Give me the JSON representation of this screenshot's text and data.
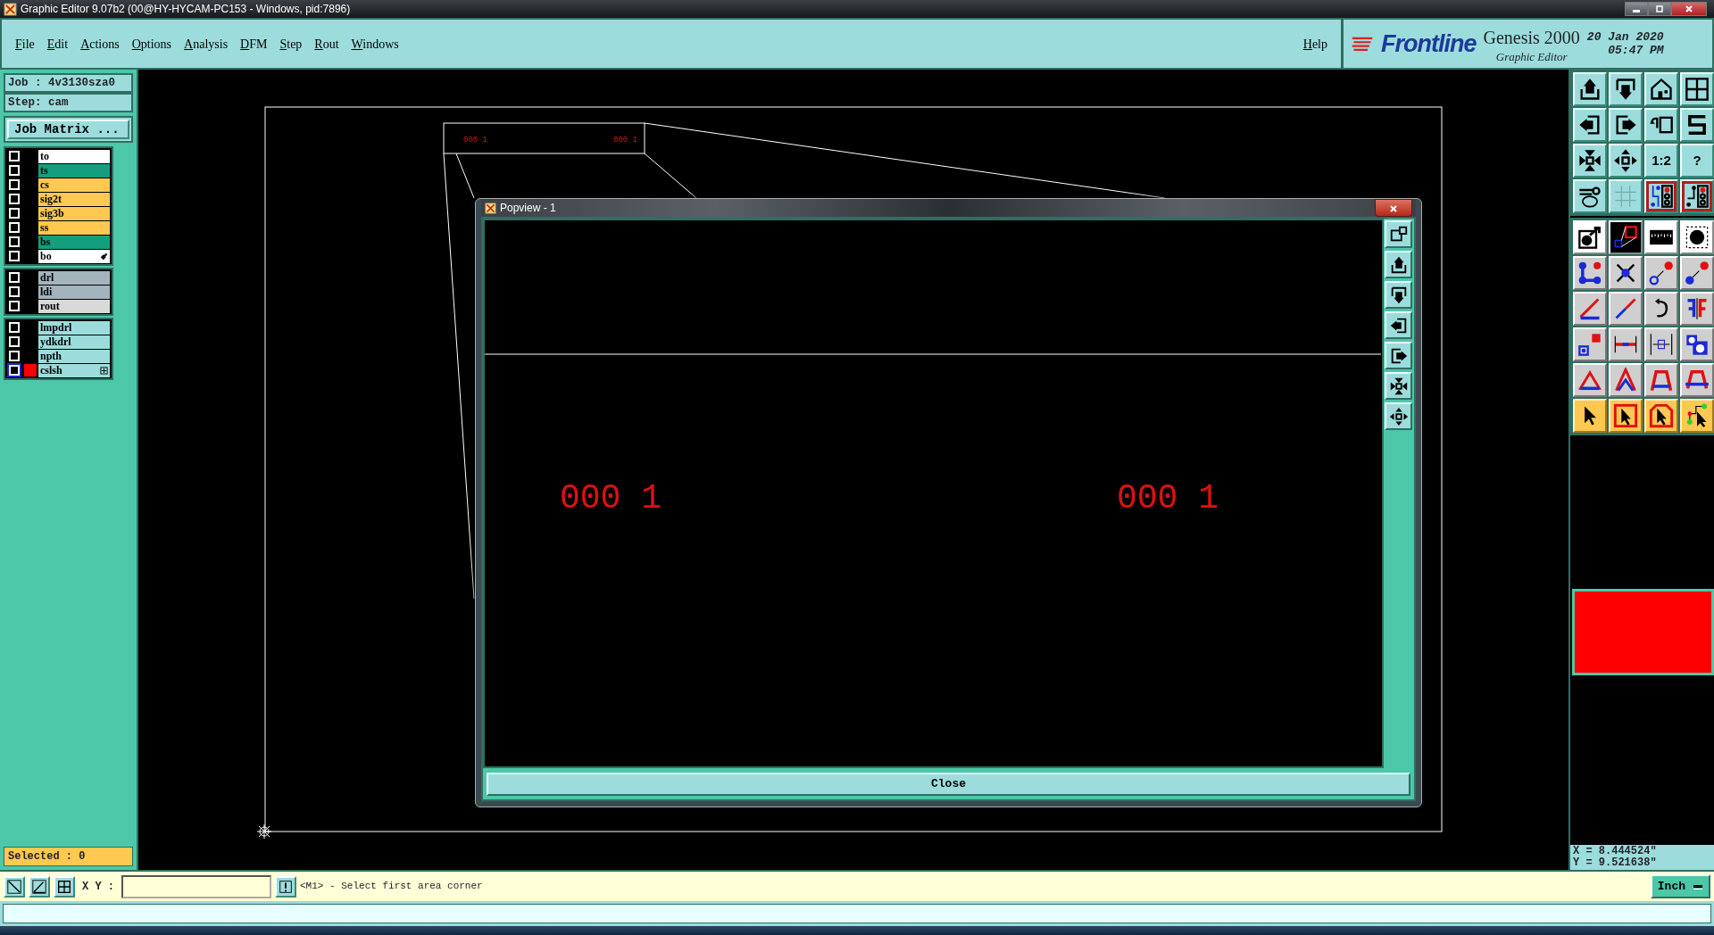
{
  "window": {
    "title": "Graphic Editor 9.07b2 (00@HY-HYCAM-PC153 - Windows, pid:7896)"
  },
  "menu": [
    {
      "label": "File"
    },
    {
      "label": "Edit"
    },
    {
      "label": "Actions"
    },
    {
      "label": "Options"
    },
    {
      "label": "Analysis"
    },
    {
      "label": "DFM"
    },
    {
      "label": "Step"
    },
    {
      "label": "Rout"
    },
    {
      "label": "Windows"
    }
  ],
  "help": "Help",
  "brand": {
    "logo": "Frontline",
    "product": "Genesis 2000",
    "subtitle": "Graphic Editor",
    "date": "20 Jan 2020",
    "time": "05:47 PM"
  },
  "job": {
    "job": "Job : 4v3130sza0",
    "step": "Step: cam",
    "matrix_button": "Job Matrix ..."
  },
  "layer_groups": [
    [
      {
        "name": "to",
        "color": "#ffffff",
        "checked": false,
        "displayed": false,
        "focused": false,
        "work": false,
        "expander": false
      },
      {
        "name": "ts",
        "color": "#139e7e",
        "checked": false,
        "displayed": false,
        "focused": false,
        "work": false,
        "expander": false
      },
      {
        "name": "cs",
        "color": "#ffc850",
        "checked": false,
        "displayed": false,
        "focused": false,
        "work": false,
        "expander": false
      },
      {
        "name": "sig2t",
        "color": "#ffc850",
        "checked": false,
        "displayed": false,
        "focused": false,
        "work": false,
        "expander": false
      },
      {
        "name": "sig3b",
        "color": "#ffc850",
        "checked": false,
        "displayed": false,
        "focused": false,
        "work": false,
        "expander": false
      },
      {
        "name": "ss",
        "color": "#ffc850",
        "checked": false,
        "displayed": false,
        "focused": false,
        "work": false,
        "expander": false
      },
      {
        "name": "bs",
        "color": "#139e7e",
        "checked": false,
        "displayed": false,
        "focused": false,
        "work": false,
        "expander": false
      },
      {
        "name": "bo",
        "color": "#ffffff",
        "checked": false,
        "displayed": false,
        "focused": false,
        "work": true,
        "expander": false
      }
    ],
    [
      {
        "name": "drl",
        "color": "#a3b4bc",
        "checked": false,
        "displayed": false,
        "focused": false,
        "work": false,
        "expander": false
      },
      {
        "name": "ldi",
        "color": "#a3b4bc",
        "checked": false,
        "displayed": false,
        "focused": false,
        "work": false,
        "expander": false
      },
      {
        "name": "rout",
        "color": "#d9d9d9",
        "checked": false,
        "displayed": false,
        "focused": false,
        "work": false,
        "expander": false
      }
    ],
    [
      {
        "name": "lmpdrl",
        "color": "#9ddcdc",
        "checked": false,
        "displayed": false,
        "focused": false,
        "work": false,
        "expander": false
      },
      {
        "name": "ydkdrl",
        "color": "#9ddcdc",
        "checked": false,
        "displayed": false,
        "focused": false,
        "work": false,
        "expander": false
      },
      {
        "name": "npth",
        "color": "#9ddcdc",
        "checked": false,
        "displayed": false,
        "focused": false,
        "work": false,
        "expander": false
      },
      {
        "name": "cslsh",
        "color": "#9ddcdc",
        "checked": false,
        "displayed": true,
        "focused": true,
        "work": false,
        "expander": true
      }
    ]
  ],
  "selected_count": "Selected : 0",
  "canvas": {
    "frame_texts": [
      "000 1",
      "000 1"
    ]
  },
  "popview": {
    "title": "Popview - 1",
    "texts": [
      "000 1",
      "000 1"
    ],
    "close": "Close"
  },
  "toolbar": [
    {
      "kind": "teal",
      "on": false
    },
    {
      "kind": "teal",
      "on": false
    },
    {
      "kind": "teal",
      "on": false
    },
    {
      "kind": "teal",
      "on": false
    },
    {
      "kind": "teal",
      "on": false
    },
    {
      "kind": "teal",
      "on": false
    },
    {
      "kind": "teal",
      "on": false
    },
    {
      "kind": "teal",
      "on": false
    },
    {
      "kind": "teal",
      "on": false
    },
    {
      "kind": "teal",
      "on": false
    },
    {
      "kind": "teal",
      "on": false,
      "label": "1:2"
    },
    {
      "kind": "teal",
      "on": false,
      "label": "?"
    },
    {
      "kind": "teal",
      "on": false
    },
    {
      "kind": "teal",
      "on": false
    },
    {
      "kind": "teal",
      "on": true
    },
    {
      "kind": "teal",
      "on": true
    },
    {
      "kind": "white",
      "on": false
    },
    {
      "kind": "dark",
      "on": false
    },
    {
      "kind": "white",
      "on": false
    },
    {
      "kind": "white",
      "on": false
    },
    {
      "kind": "grey",
      "on": false
    },
    {
      "kind": "grey",
      "on": false
    },
    {
      "kind": "grey",
      "on": false
    },
    {
      "kind": "grey",
      "on": false
    },
    {
      "kind": "grey",
      "on": false
    },
    {
      "kind": "grey",
      "on": false
    },
    {
      "kind": "grey",
      "on": false
    },
    {
      "kind": "grey",
      "on": false
    },
    {
      "kind": "grey",
      "on": false
    },
    {
      "kind": "grey",
      "on": false
    },
    {
      "kind": "grey",
      "on": false
    },
    {
      "kind": "grey",
      "on": false
    },
    {
      "kind": "grey",
      "on": false
    },
    {
      "kind": "grey",
      "on": false
    },
    {
      "kind": "grey",
      "on": false
    },
    {
      "kind": "grey",
      "on": false
    },
    {
      "kind": "yellow",
      "on": false
    },
    {
      "kind": "yellow",
      "on": false
    },
    {
      "kind": "yellow",
      "on": false
    },
    {
      "kind": "yellow",
      "on": false
    }
  ],
  "readout": {
    "x": "X = 8.444524\"",
    "y": "Y = 9.521638\""
  },
  "status": {
    "xy_label": "X Y :",
    "prompt": "<M1> - Select first area corner",
    "units": "Inch"
  }
}
